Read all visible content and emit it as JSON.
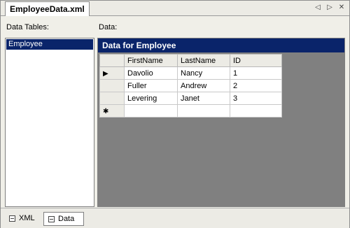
{
  "document": {
    "tab_title": "EmployeeData.xml"
  },
  "tab_controls": {
    "prev_icon": "triangle-left",
    "next_icon": "triangle-right",
    "close_icon": "x"
  },
  "labels": {
    "data_tables": "Data Tables:",
    "data": "Data:"
  },
  "data_tables": {
    "items": [
      "Employee"
    ],
    "selected": "Employee"
  },
  "grid": {
    "caption": "Data for Employee",
    "columns": [
      "FirstName",
      "LastName",
      "ID"
    ],
    "rows": [
      [
        "Davolio",
        "Nancy",
        "1"
      ],
      [
        "Fuller",
        "Andrew",
        "2"
      ],
      [
        "Levering",
        "Janet",
        "3"
      ]
    ],
    "current_row_indicator": "▶",
    "new_row_indicator": "✱"
  },
  "view_tabs": {
    "xml": "XML",
    "data": "Data",
    "active": "Data"
  },
  "colors": {
    "selection_blue": "#0a246a",
    "grid_background": "#808080",
    "chrome": "#ecebe5"
  }
}
